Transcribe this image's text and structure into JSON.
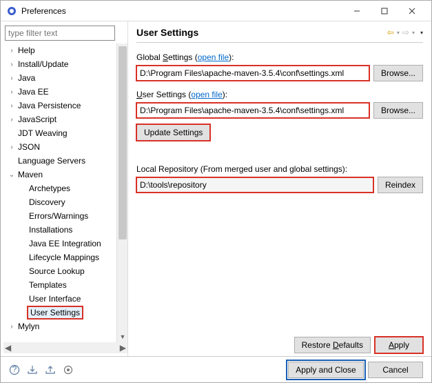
{
  "window": {
    "title": "Preferences"
  },
  "filter": {
    "placeholder": "type filter text"
  },
  "tree": {
    "items": [
      {
        "label": "Help",
        "depth": 0,
        "arrow": ">"
      },
      {
        "label": "Install/Update",
        "depth": 0,
        "arrow": ">"
      },
      {
        "label": "Java",
        "depth": 0,
        "arrow": ">"
      },
      {
        "label": "Java EE",
        "depth": 0,
        "arrow": ">"
      },
      {
        "label": "Java Persistence",
        "depth": 0,
        "arrow": ">"
      },
      {
        "label": "JavaScript",
        "depth": 0,
        "arrow": ">"
      },
      {
        "label": "JDT Weaving",
        "depth": 0,
        "arrow": ""
      },
      {
        "label": "JSON",
        "depth": 0,
        "arrow": ">"
      },
      {
        "label": "Language Servers",
        "depth": 0,
        "arrow": ""
      },
      {
        "label": "Maven",
        "depth": 0,
        "arrow": "v",
        "expanded": true
      },
      {
        "label": "Archetypes",
        "depth": 1,
        "arrow": ""
      },
      {
        "label": "Discovery",
        "depth": 1,
        "arrow": ""
      },
      {
        "label": "Errors/Warnings",
        "depth": 1,
        "arrow": ""
      },
      {
        "label": "Installations",
        "depth": 1,
        "arrow": ""
      },
      {
        "label": "Java EE Integration",
        "depth": 1,
        "arrow": ""
      },
      {
        "label": "Lifecycle Mappings",
        "depth": 1,
        "arrow": ""
      },
      {
        "label": "Source Lookup",
        "depth": 1,
        "arrow": ""
      },
      {
        "label": "Templates",
        "depth": 1,
        "arrow": ""
      },
      {
        "label": "User Interface",
        "depth": 1,
        "arrow": ""
      },
      {
        "label": "User Settings",
        "depth": 1,
        "arrow": "",
        "selected": true,
        "highlighted": true
      },
      {
        "label": "Mylyn",
        "depth": 0,
        "arrow": ">"
      }
    ]
  },
  "page": {
    "heading": "User Settings",
    "global_prefix": "Global ",
    "global_u": "S",
    "global_suffix": "ettings",
    "open_file": "open file",
    "global_value": "D:\\Program Files\\apache-maven-3.5.4\\conf\\settings.xml",
    "browse": "Browse...",
    "user_u": "U",
    "user_suffix": "ser Settings",
    "user_value": "D:\\Program Files\\apache-maven-3.5.4\\conf\\settings.xml",
    "update": "Update Settings",
    "local_label": "Local Repository (From merged user and global settings):",
    "local_value": "D:\\tools\\repository",
    "reindex": "Reindex",
    "restore": "Restore ",
    "restore_u": "D",
    "restore_suffix": "efaults",
    "apply_u": "A",
    "apply_suffix": "pply"
  },
  "footer": {
    "apply_close": "Apply and Close",
    "cancel": "Cancel"
  }
}
